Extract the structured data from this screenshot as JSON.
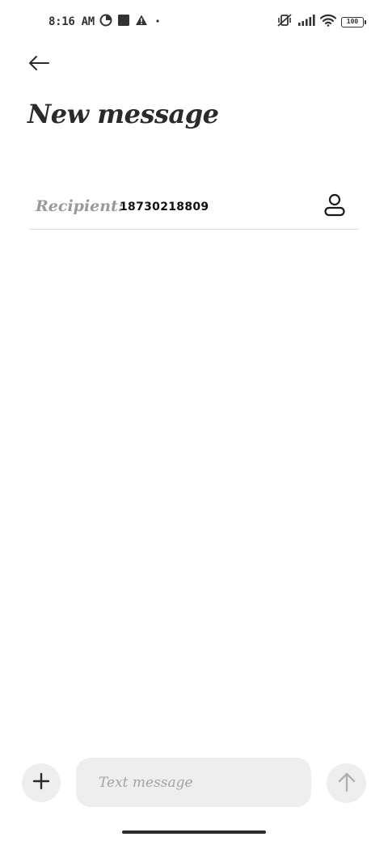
{
  "status_bar": {
    "time": "8:16 AM",
    "battery_level": "100",
    "left_icons": [
      "data-saver-icon",
      "stop-square-icon",
      "alert-triangle-icon",
      "dot-icon"
    ],
    "right_icons": [
      "vibrate-off-icon",
      "signal-bars-icon",
      "wifi-icon",
      "battery-icon"
    ]
  },
  "header": {
    "title": "New message",
    "back_icon": "arrow-left-icon"
  },
  "recipient": {
    "label": "Recipient:",
    "value": "18730218809",
    "contact_icon": "person-icon"
  },
  "composer": {
    "placeholder": "Text message",
    "add_icon": "plus-icon",
    "send_icon": "arrow-up-icon"
  },
  "colors": {
    "background": "#ffffff",
    "text_primary": "#222222",
    "text_muted": "#9a9a9a",
    "surface": "#eeeeee",
    "divider": "#d9d9d9"
  }
}
